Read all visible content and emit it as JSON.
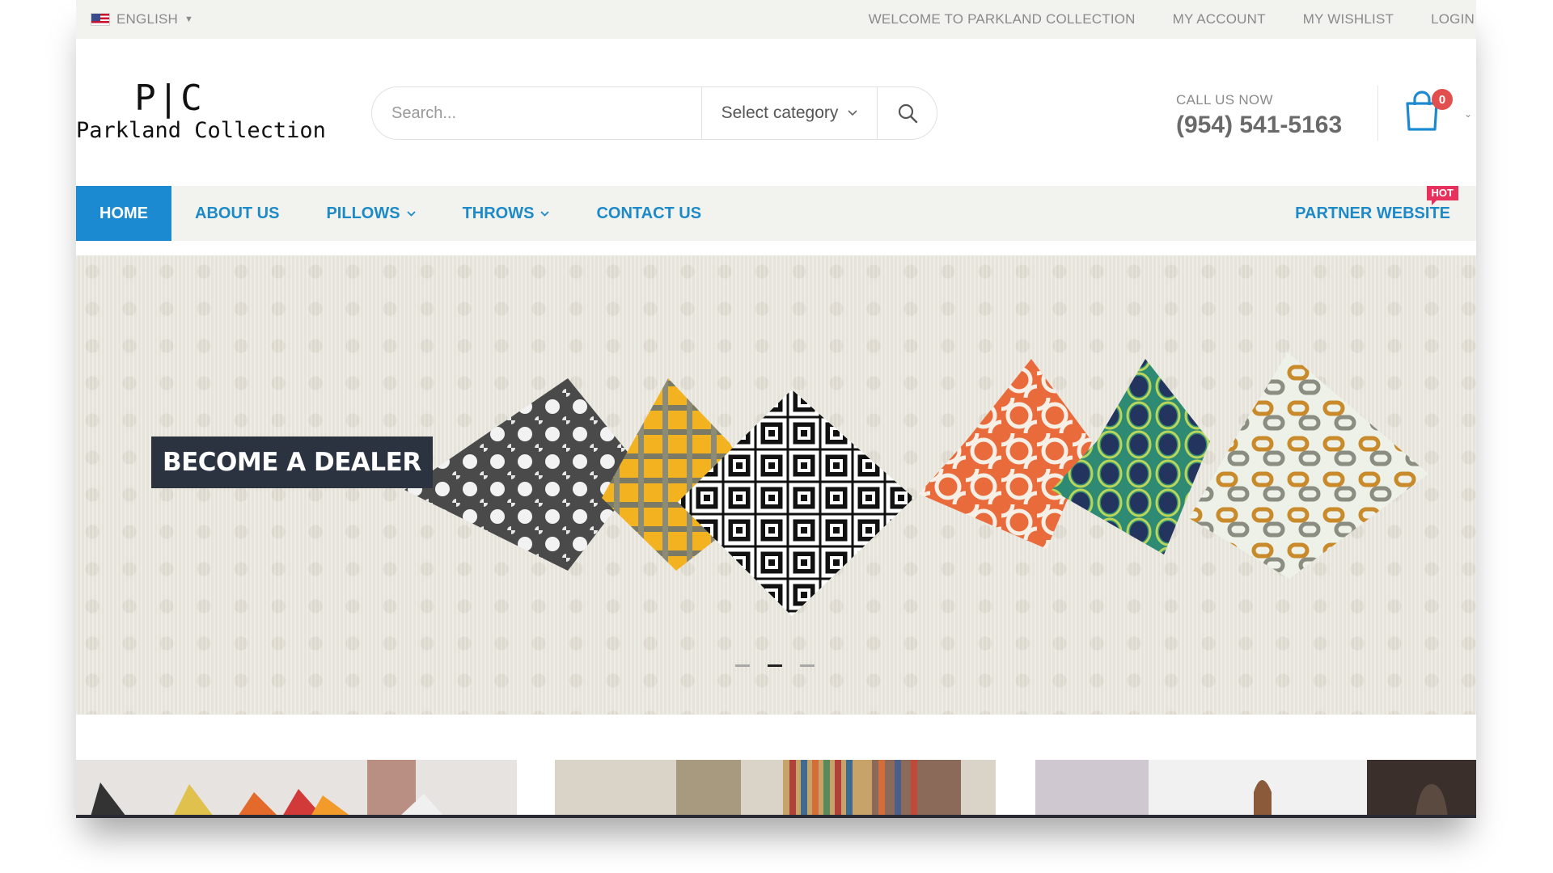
{
  "topbar": {
    "language": "ENGLISH",
    "welcome": "WELCOME TO PARKLAND COLLECTION",
    "my_account": "MY ACCOUNT",
    "my_wishlist": "MY WISHLIST",
    "login": "LOGIN"
  },
  "header": {
    "logo_mark": "P|C",
    "logo_text": "Parkland Collection",
    "search_placeholder": "Search...",
    "category_select": "Select category",
    "call_label": "CALL US NOW",
    "phone": "(954) 541-5163",
    "cart_count": "0"
  },
  "nav": {
    "items": [
      {
        "label": "HOME"
      },
      {
        "label": "ABOUT US"
      },
      {
        "label": "PILLOWS"
      },
      {
        "label": "THROWS"
      },
      {
        "label": "CONTACT US"
      }
    ],
    "partner": "PARTNER WEBSITE",
    "hot_badge": "HOT"
  },
  "slider": {
    "cta": "BECOME A DEALER",
    "active_slide": 2,
    "slide_count": 3
  },
  "colors": {
    "accent": "#1b8ad1",
    "topbar_bg": "#f2f2ef",
    "cart_badge": "#e24f4f",
    "hot_badge": "#e8305c",
    "dealer_bg": "#2b3340"
  }
}
